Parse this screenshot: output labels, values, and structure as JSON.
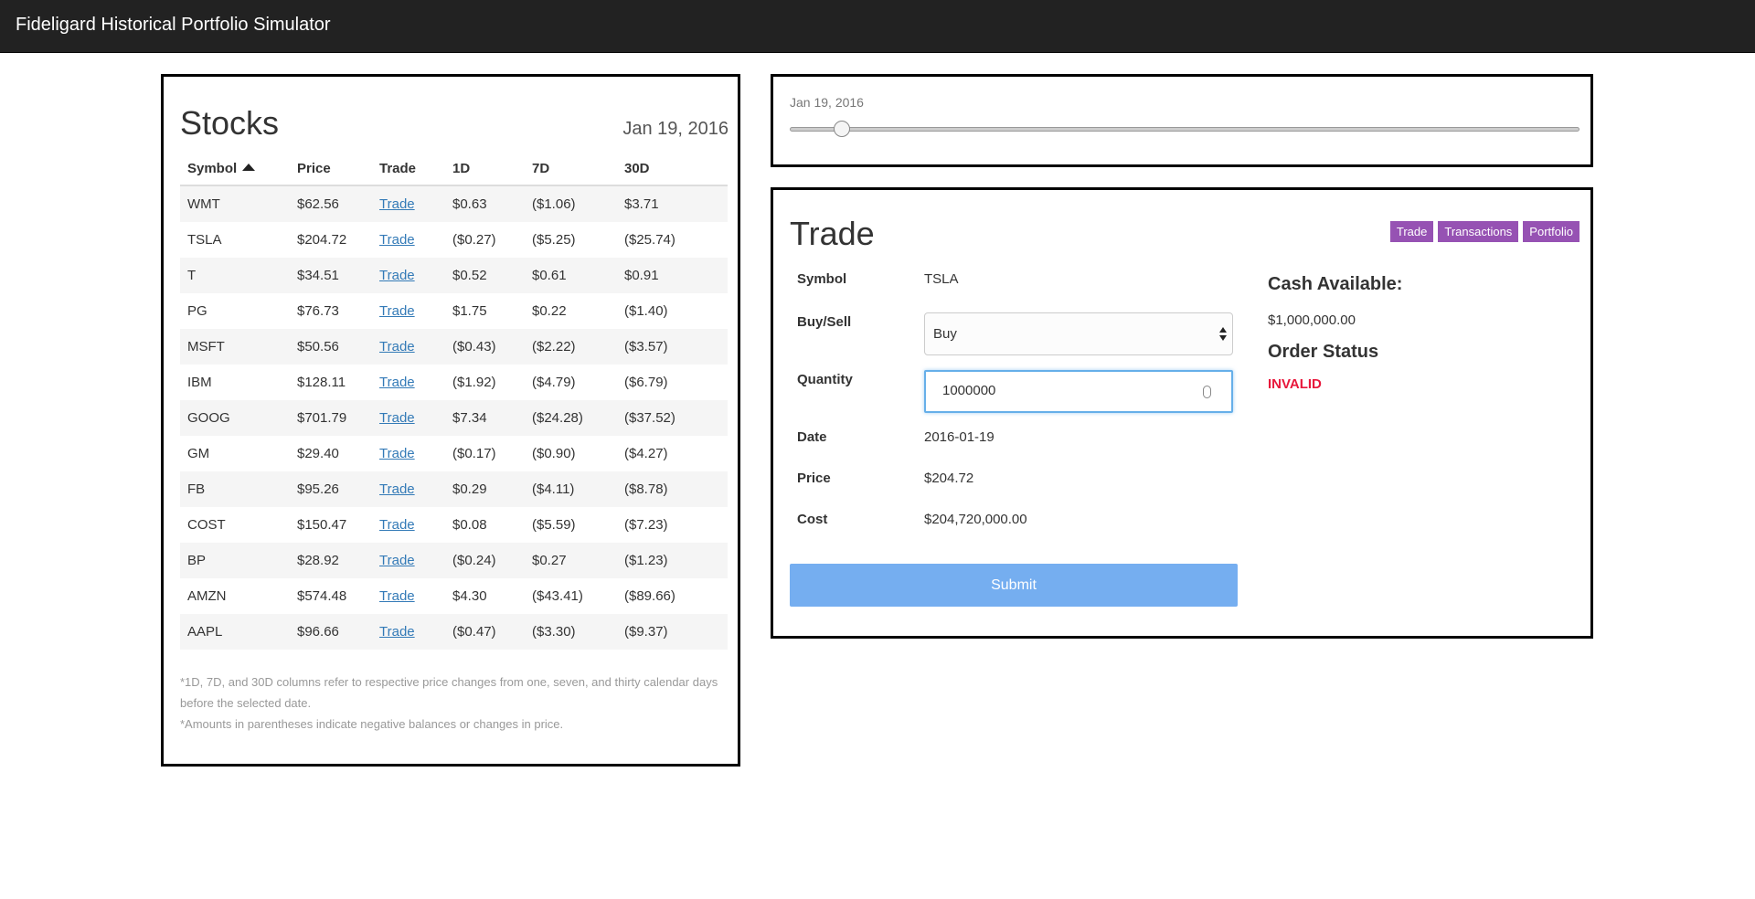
{
  "header": {
    "title": "Fideligard Historical Portfolio Simulator"
  },
  "stocks": {
    "heading": "Stocks",
    "date": "Jan 19, 2016",
    "columns": [
      "Symbol",
      "Price",
      "Trade",
      "1D",
      "7D",
      "30D"
    ],
    "sort_column": "Symbol",
    "sort_direction": "ascending-icon",
    "rows": [
      {
        "symbol": "WMT",
        "price": "$62.56",
        "trade": "Trade",
        "d1": "$0.63",
        "d7": "($1.06)",
        "d30": "$3.71"
      },
      {
        "symbol": "TSLA",
        "price": "$204.72",
        "trade": "Trade",
        "d1": "($0.27)",
        "d7": "($5.25)",
        "d30": "($25.74)"
      },
      {
        "symbol": "T",
        "price": "$34.51",
        "trade": "Trade",
        "d1": "$0.52",
        "d7": "$0.61",
        "d30": "$0.91"
      },
      {
        "symbol": "PG",
        "price": "$76.73",
        "trade": "Trade",
        "d1": "$1.75",
        "d7": "$0.22",
        "d30": "($1.40)"
      },
      {
        "symbol": "MSFT",
        "price": "$50.56",
        "trade": "Trade",
        "d1": "($0.43)",
        "d7": "($2.22)",
        "d30": "($3.57)"
      },
      {
        "symbol": "IBM",
        "price": "$128.11",
        "trade": "Trade",
        "d1": "($1.92)",
        "d7": "($4.79)",
        "d30": "($6.79)"
      },
      {
        "symbol": "GOOG",
        "price": "$701.79",
        "trade": "Trade",
        "d1": "$7.34",
        "d7": "($24.28)",
        "d30": "($37.52)"
      },
      {
        "symbol": "GM",
        "price": "$29.40",
        "trade": "Trade",
        "d1": "($0.17)",
        "d7": "($0.90)",
        "d30": "($4.27)"
      },
      {
        "symbol": "FB",
        "price": "$95.26",
        "trade": "Trade",
        "d1": "$0.29",
        "d7": "($4.11)",
        "d30": "($8.78)"
      },
      {
        "symbol": "COST",
        "price": "$150.47",
        "trade": "Trade",
        "d1": "$0.08",
        "d7": "($5.59)",
        "d30": "($7.23)"
      },
      {
        "symbol": "BP",
        "price": "$28.92",
        "trade": "Trade",
        "d1": "($0.24)",
        "d7": "$0.27",
        "d30": "($1.23)"
      },
      {
        "symbol": "AMZN",
        "price": "$574.48",
        "trade": "Trade",
        "d1": "$4.30",
        "d7": "($43.41)",
        "d30": "($89.66)"
      },
      {
        "symbol": "AAPL",
        "price": "$96.66",
        "trade": "Trade",
        "d1": "($0.47)",
        "d7": "($3.30)",
        "d30": "($9.37)"
      }
    ],
    "notes": [
      "*1D, 7D, and 30D columns refer to respective price changes from one, seven, and thirty calendar days before the selected date.",
      "*Amounts in parentheses indicate negative balances or changes in price."
    ]
  },
  "date_slider": {
    "label": "Jan 19, 2016",
    "position_fraction": 0.057
  },
  "trade": {
    "heading": "Trade",
    "tabs": [
      "Trade",
      "Transactions",
      "Portfolio"
    ],
    "fields": {
      "symbol_label": "Symbol",
      "symbol_value": "TSLA",
      "buysell_label": "Buy/Sell",
      "buysell_value": "Buy",
      "quantity_label": "Quantity",
      "quantity_value": "1000000",
      "date_label": "Date",
      "date_value": "2016-01-19",
      "price_label": "Price",
      "price_value": "$204.72",
      "cost_label": "Cost",
      "cost_value": "$204,720,000.00"
    },
    "submit_label": "Submit",
    "cash_title": "Cash Available:",
    "cash_value": "$1,000,000.00",
    "status_title": "Order Status",
    "status_value": "INVALID"
  },
  "colors": {
    "topbar": "#222222",
    "tab": "#8e44ad",
    "submit": "#75aef0",
    "invalid": "#e8173b",
    "link": "#337ab7"
  }
}
